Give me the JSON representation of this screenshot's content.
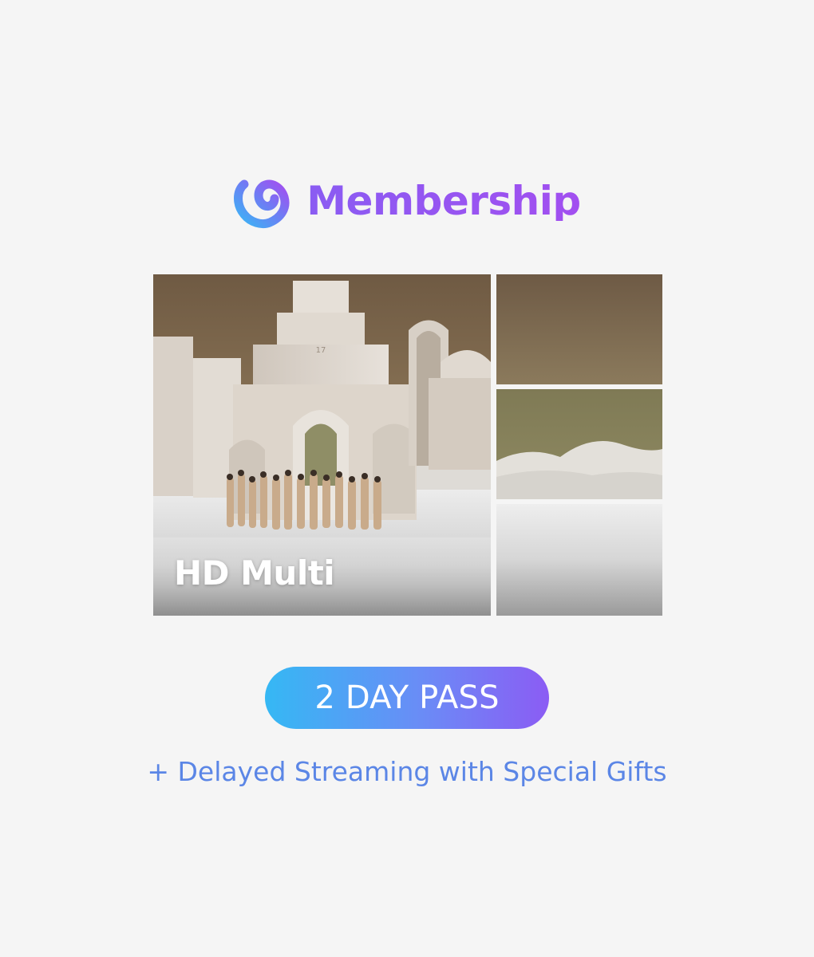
{
  "brand": {
    "name": "Membership",
    "icon": "membership-heart-logo",
    "colors": {
      "gradient_start": "#3ab6f5",
      "gradient_end": "#9b4ff0",
      "text": "#9a56f0"
    }
  },
  "hero": {
    "label": "HD Multi",
    "tiles": [
      "top-tile",
      "middle-tile",
      "bottom-tile"
    ]
  },
  "pass": {
    "label": "2 DAY PASS",
    "colors": {
      "start": "#35b8f4",
      "end": "#8b5cf4"
    }
  },
  "subtitle": "+ Delayed Streaming with Special Gifts"
}
